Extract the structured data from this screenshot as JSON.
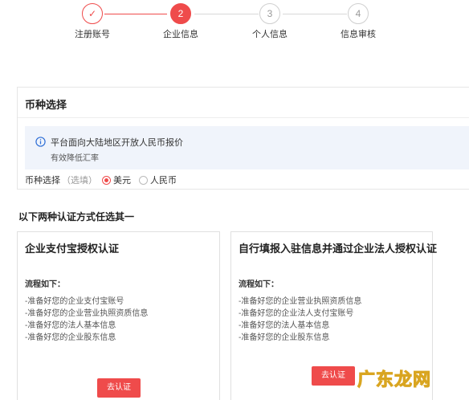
{
  "stepper": {
    "steps": [
      {
        "label": "注册账号",
        "marker": "✓",
        "state": "done"
      },
      {
        "label": "企业信息",
        "marker": "2",
        "state": "active"
      },
      {
        "label": "个人信息",
        "marker": "3",
        "state": "todo"
      },
      {
        "label": "信息审核",
        "marker": "4",
        "state": "todo"
      }
    ]
  },
  "currency": {
    "title": "币种选择",
    "notice": {
      "icon": "info-circle-icon",
      "main": "平台面向大陆地区开放人民币报价",
      "sub": "有效降低汇率"
    },
    "field_label": "币种选择",
    "field_hint": "（选填）",
    "options": [
      {
        "label": "美元",
        "selected": true
      },
      {
        "label": "人民币",
        "selected": false
      }
    ]
  },
  "cert": {
    "heading": "以下两种认证方式任选其一",
    "cards": [
      {
        "title": "企业支付宝授权认证",
        "subtitle": "流程如下：",
        "items": [
          "-准备好您的企业支付宝账号",
          "-准备好您的企业营业执照资质信息",
          "-准备好您的法人基本信息",
          "-准备好您的企业股东信息"
        ],
        "button": "去认证"
      },
      {
        "title": "自行填报入驻信息并通过企业法人授权认证",
        "subtitle": "流程如下：",
        "items": [
          "-准备好您的企业营业执照资质信息",
          "-准备好您的企业法人支付宝账号",
          "-准备好您的法人基本信息",
          "-准备好您的企业股东信息"
        ],
        "button": "去认证"
      }
    ]
  },
  "watermark": "广东龙网",
  "colors": {
    "accent": "#ef4b4b",
    "muted_line": "#d8d8d8",
    "notice_bg": "#f0f4fb"
  }
}
